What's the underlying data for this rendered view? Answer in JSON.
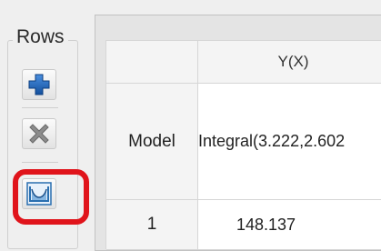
{
  "rows_panel": {
    "title": "Rows",
    "buttons": {
      "add": "plus-icon",
      "remove": "x-icon",
      "integrate": "integrate-icon"
    }
  },
  "table": {
    "column_header": "Y(X)",
    "rows": [
      {
        "header": "Model",
        "value": "Integral(3.222,2.602"
      },
      {
        "header": "1",
        "value": "148.137"
      }
    ]
  },
  "colors": {
    "highlight": "#e0141b",
    "add_icon": "#1a5fb4",
    "remove_icon": "#8a8a8a",
    "integrate_icon": "#2a6fb0"
  }
}
